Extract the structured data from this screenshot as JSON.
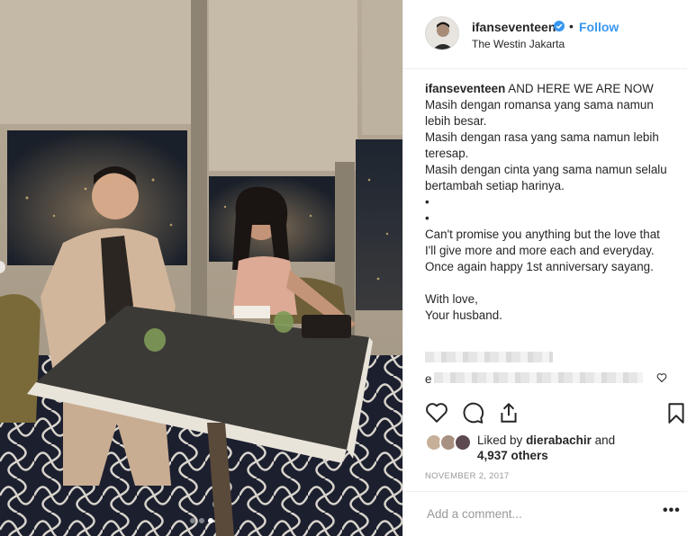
{
  "header": {
    "username": "ifanseventeen",
    "separator": "•",
    "follow_label": "Follow",
    "location": "The Westin Jakarta"
  },
  "caption": {
    "username": "ifanseventeen",
    "first_line": "AND HERE WE ARE NOW",
    "lines": [
      "Masih dengan romansa yang sama namun lebih besar.",
      "Masih dengan rasa yang sama namun lebih teresap.",
      "Masih dengan cinta yang sama namun selalu bertambah setiap harinya.",
      "•",
      "•",
      "Can't promise you anything but the love that I'll give more and more each and everyday.",
      "Once again happy 1st anniversary sayang.",
      "",
      "With love,",
      "Your husband."
    ]
  },
  "comments": {
    "partial_letter": "e"
  },
  "likes": {
    "prefix": "Liked by",
    "liker": "dierabachir",
    "conjunction": "and",
    "others": "4,937 others"
  },
  "date": "NOVEMBER 2, 2017",
  "comment_box": {
    "placeholder": "Add a comment...",
    "more_label": "•••"
  },
  "carousel": {
    "total": 3,
    "active_index": 2
  },
  "colors": {
    "accent": "#3897f0",
    "text": "#262626",
    "muted": "#999999",
    "border": "#efefef"
  },
  "icons": [
    "verified-badge-icon",
    "heart-icon",
    "comment-icon",
    "share-icon",
    "bookmark-icon",
    "small-heart-icon",
    "more-options-icon"
  ]
}
